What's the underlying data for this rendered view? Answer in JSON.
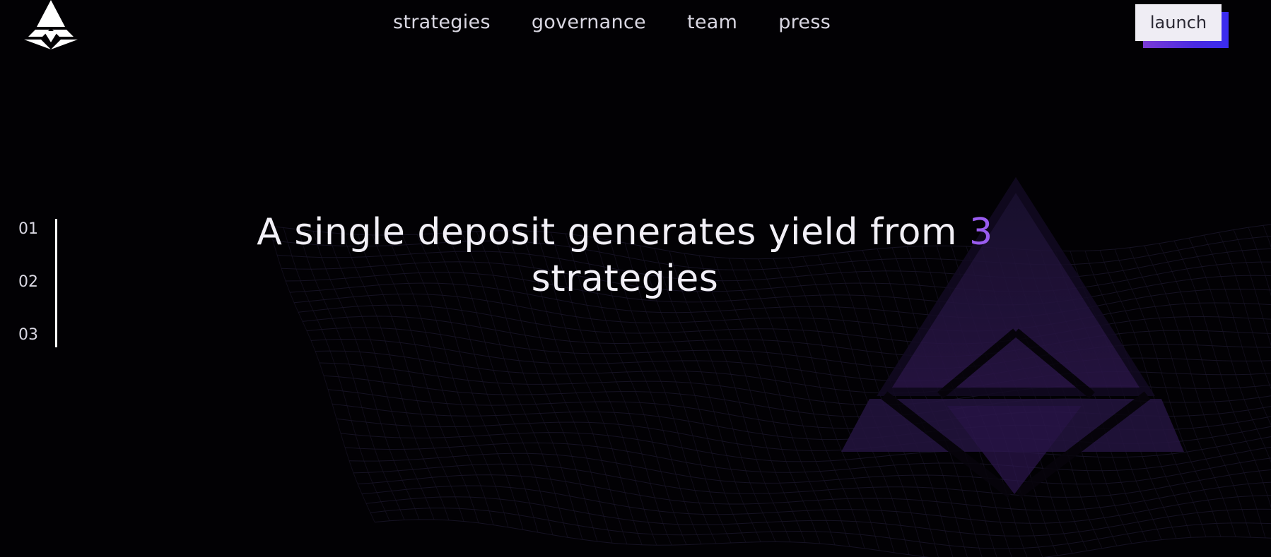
{
  "nav": {
    "items": [
      {
        "label": "strategies"
      },
      {
        "label": "governance"
      },
      {
        "label": "team"
      },
      {
        "label": "press"
      }
    ],
    "launch_label": "launch"
  },
  "steps": [
    "01",
    "02",
    "03"
  ],
  "hero": {
    "line_before": "A single deposit generates yield from",
    "number": "3",
    "line_after": "strategies"
  },
  "colors": {
    "background": "#020104",
    "accent": "#9a5cf0",
    "wave": "#3b2f9a",
    "launch_shadow": "#4a2be0"
  },
  "icons": {
    "logo": "triangle-logo-icon",
    "background_logo": "triangle-logo-watermark"
  }
}
